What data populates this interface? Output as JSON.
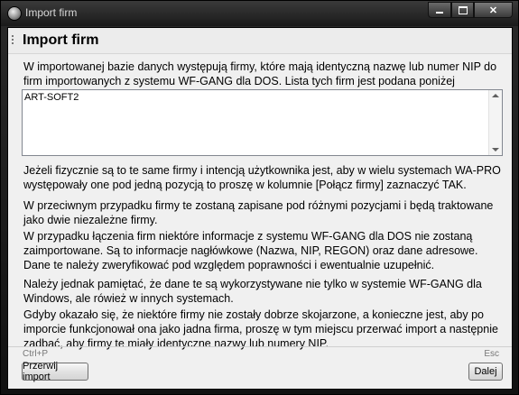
{
  "window": {
    "title": "Import firm",
    "controls": [
      "minimize",
      "maximize",
      "close"
    ]
  },
  "header": {
    "title": "Import firm"
  },
  "intro": "W importowanej bazie danych występują firmy, które mają identyczną nazwę lub numer NIP do firm importowanych z systemu WF-GANG dla DOS. Lista tych firm jest podana poniżej",
  "firm_list": {
    "items": [
      "ART-SOFT2"
    ]
  },
  "paragraphs": [
    "Jeżeli fizycznie są to te same firmy i intencją użytkownika jest, aby w wielu systemach WA-PRO występowały one pod jedną pozycją to proszę w kolumnie [Połącz firmy] zaznaczyć TAK.",
    "W przeciwnym przypadku firmy te zostaną zapisane pod różnymi pozycjami i będą traktowane jako dwie niezależne firmy.",
    "W przypadku łączenia firm niektóre informacje z systemu WF-GANG dla DOS nie zostaną zaimportowane. Są to informacje nagłówkowe (Nazwa, NIP, REGON) oraz dane adresowe. Dane te należy zweryfikować pod względem poprawności i ewentualnie uzupełnić.",
    "Należy jednak pamiętać, że dane te są wykorzystywane nie tylko w systemie WF-GANG dla Windows, ale rówież w innych systemach.",
    "Gdyby okazało się, że niektóre firmy nie zostały dobrze skojarzone, a konieczne jest, aby po imporcie funkcjonował ona jako jadna firma, proszę w tym miejscu przerwać import a następnie zadbać, aby firmy te miały identyczne nazwy lub numery NIP."
  ],
  "footer": {
    "abort_shortcut": "Ctrl+P",
    "abort_label": "Przerwij import",
    "next_shortcut": "Esc",
    "next_label": "Dalej"
  }
}
